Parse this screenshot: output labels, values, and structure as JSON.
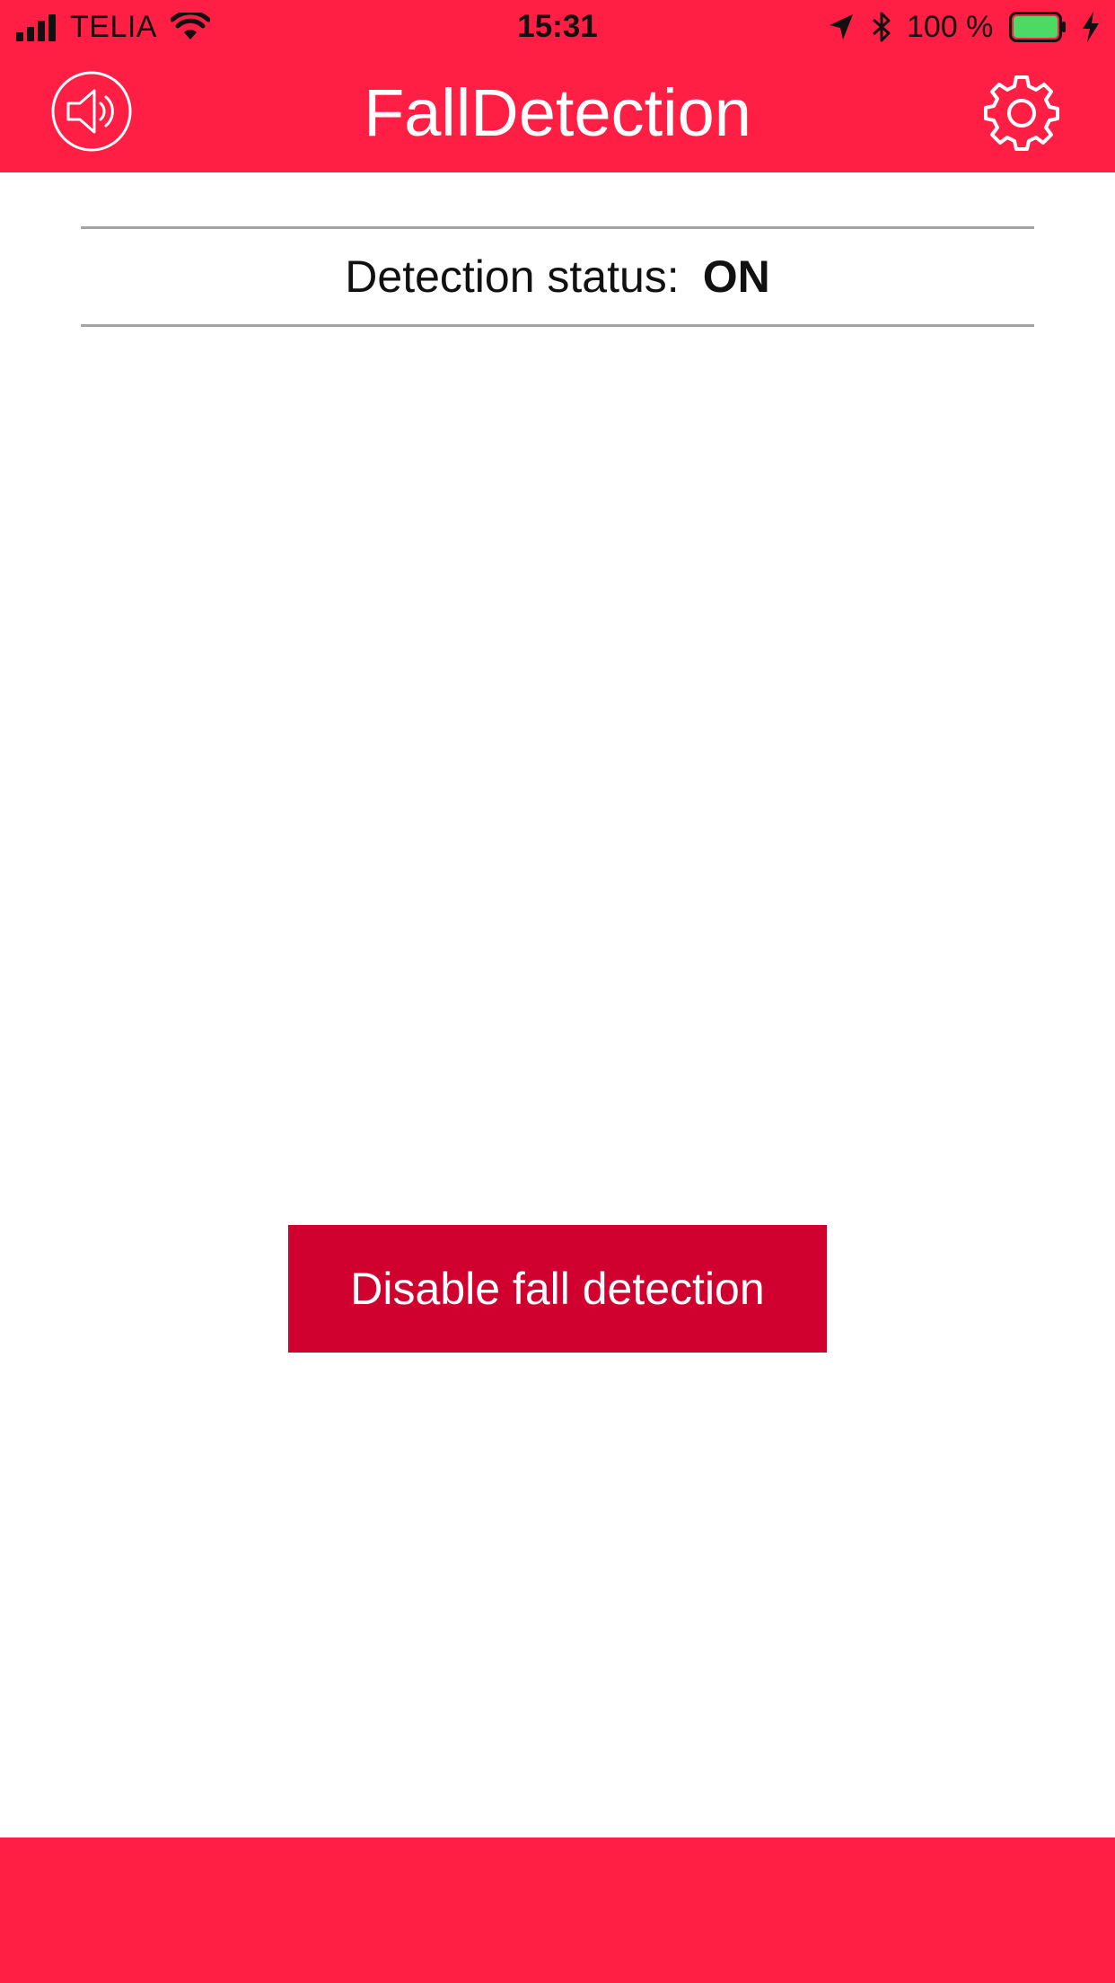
{
  "status_bar": {
    "carrier": "TELIA",
    "time": "15:31",
    "battery_percent": "100 %",
    "icons": [
      "signal-icon",
      "wifi-icon",
      "location-arrow-icon",
      "bluetooth-icon",
      "battery-icon",
      "charging-bolt-icon"
    ]
  },
  "header": {
    "title": "FallDetection",
    "left_icon": "speaker-icon",
    "right_icon": "gear-icon"
  },
  "detection": {
    "label": "Detection status:",
    "value": "ON"
  },
  "actions": {
    "disable_label": "Disable fall detection"
  },
  "colors": {
    "brand_red": "#ff1f44",
    "button_red": "#d0002f",
    "battery_green": "#4cd964",
    "divider_gray": "#a3a3a3"
  }
}
